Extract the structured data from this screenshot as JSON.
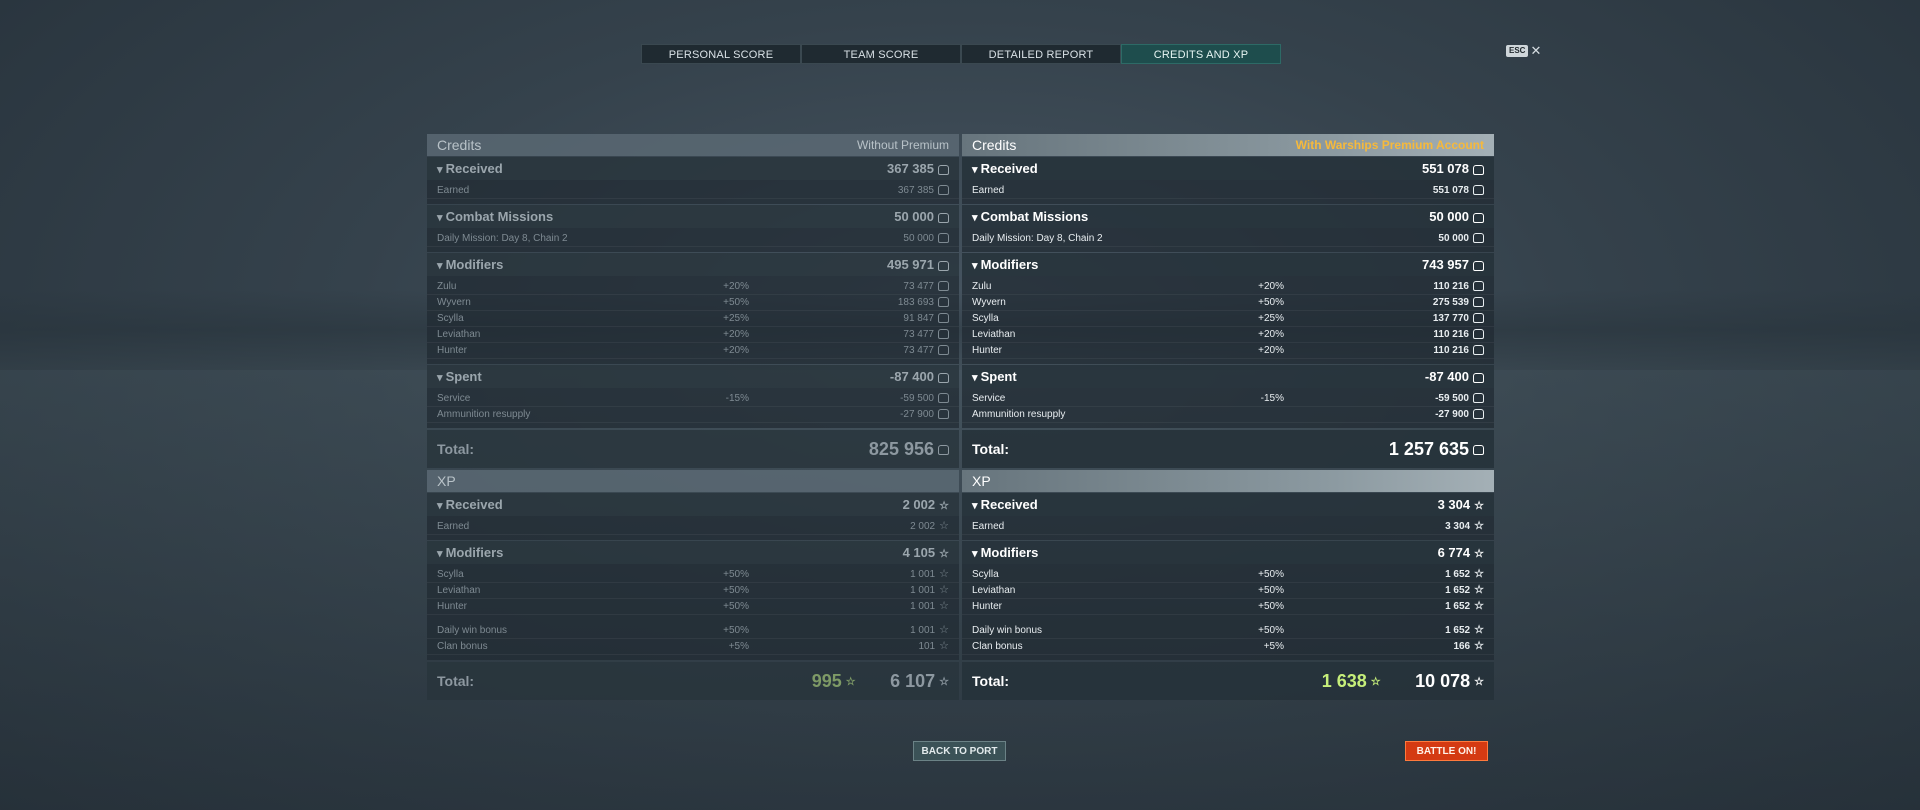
{
  "tabs": [
    "PERSONAL SCORE",
    "TEAM SCORE",
    "DETAILED REPORT",
    "CREDITS AND XP"
  ],
  "esc": {
    "key": "ESC",
    "close": "✕"
  },
  "credits": {
    "title": "Credits",
    "left_sub": "Without Premium",
    "right_sub": "With Warships Premium Account",
    "received": {
      "label": "Received",
      "left": "367 385",
      "right": "551 078"
    },
    "earned": {
      "label": "Earned",
      "left": "367 385",
      "right": "551 078"
    },
    "missions": {
      "label": "Combat Missions",
      "left": "50 000",
      "right": "50 000"
    },
    "mission_row": {
      "label": "Daily Mission: Day 8, Chain 2",
      "left": "50 000",
      "right": "50 000"
    },
    "modifiers": {
      "label": "Modifiers",
      "left": "495 971",
      "right": "743 957"
    },
    "modifier_rows": [
      {
        "label": "Zulu",
        "pct": "+20%",
        "left": "73 477",
        "right": "110 216"
      },
      {
        "label": "Wyvern",
        "pct": "+50%",
        "left": "183 693",
        "right": "275 539"
      },
      {
        "label": "Scylla",
        "pct": "+25%",
        "left": "91 847",
        "right": "137 770"
      },
      {
        "label": "Leviathan",
        "pct": "+20%",
        "left": "73 477",
        "right": "110 216"
      },
      {
        "label": "Hunter",
        "pct": "+20%",
        "left": "73 477",
        "right": "110 216"
      }
    ],
    "spent": {
      "label": "Spent",
      "left": "-87 400",
      "right": "-87 400"
    },
    "spent_rows": [
      {
        "label": "Service",
        "pct": "-15%",
        "left": "-59 500",
        "right": "-59 500"
      },
      {
        "label": "Ammunition resupply",
        "pct": "",
        "left": "-27 900",
        "right": "-27 900"
      }
    ],
    "total": {
      "label": "Total:",
      "left": "825 956",
      "right": "1 257 635"
    }
  },
  "xp": {
    "title": "XP",
    "received": {
      "label": "Received",
      "left": "2 002",
      "right": "3 304"
    },
    "earned": {
      "label": "Earned",
      "left": "2 002",
      "right": "3 304"
    },
    "modifiers": {
      "label": "Modifiers",
      "left": "4 105",
      "right": "6 774"
    },
    "modifier_rows": [
      {
        "label": "Scylla",
        "pct": "+50%",
        "left": "1 001",
        "right": "1 652"
      },
      {
        "label": "Leviathan",
        "pct": "+50%",
        "left": "1 001",
        "right": "1 652"
      },
      {
        "label": "Hunter",
        "pct": "+50%",
        "left": "1 001",
        "right": "1 652"
      }
    ],
    "bonus_rows": [
      {
        "label": "Daily win bonus",
        "pct": "+50%",
        "left": "1 001",
        "right": "1 652"
      },
      {
        "label": "Clan bonus",
        "pct": "+5%",
        "left": "101",
        "right": "166"
      }
    ],
    "total": {
      "label": "Total:",
      "left_extra": "995",
      "left": "6 107",
      "right_extra": "1 638",
      "right": "10 078"
    }
  },
  "buttons": {
    "back": "BACK TO PORT",
    "battle": "BATTLE ON!"
  },
  "colors": {
    "premium": "#f6b93b",
    "battle": "#d43a12",
    "xp_extra": "#c6ef7a"
  },
  "icons": {
    "credits": "coin-icon",
    "xp": "star-icon"
  }
}
